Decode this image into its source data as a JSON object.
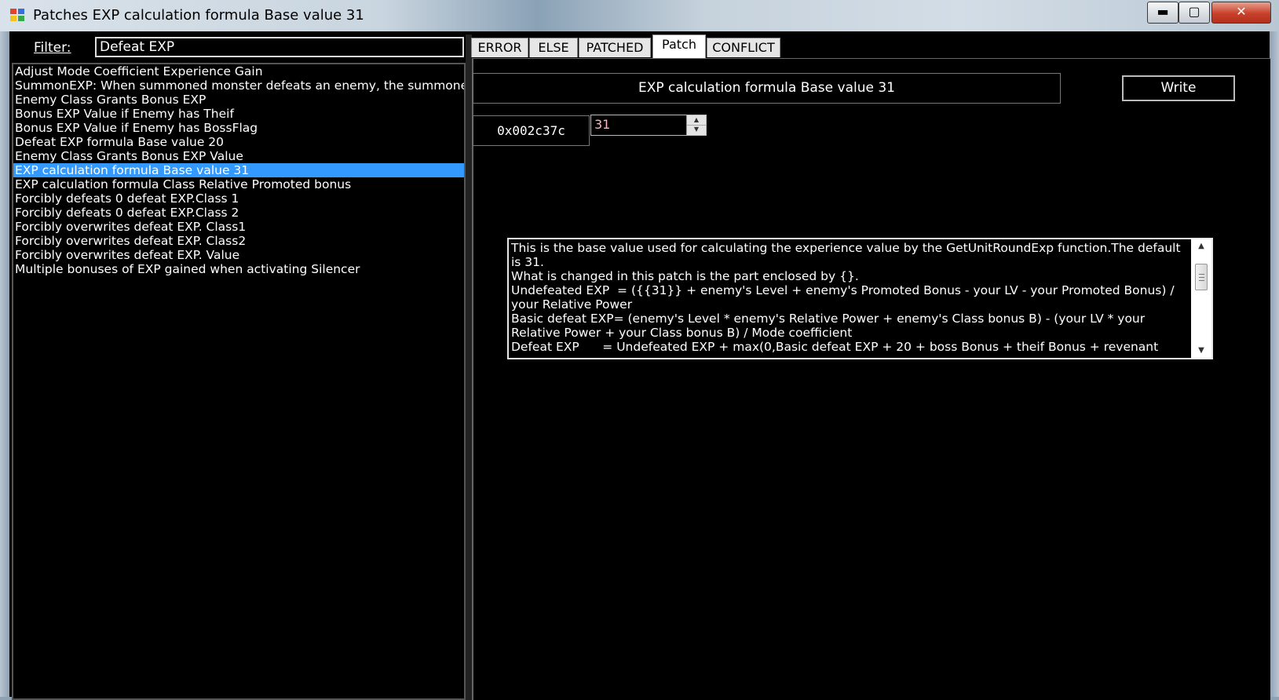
{
  "window": {
    "title": "Patches EXP calculation formula Base value 31",
    "min_icon": "minimize-icon",
    "max_icon": "maximize-icon",
    "close_icon": "close-icon",
    "min_glyph": "▬",
    "max_glyph": "▢",
    "close_glyph": "✕"
  },
  "filter": {
    "label": "Filter:",
    "value": "Defeat EXP"
  },
  "patch_list": {
    "items": [
      "Adjust Mode Coefficient Experience Gain",
      "SummonEXP: When summoned monster defeats an enemy, the summoner g",
      "Enemy Class Grants Bonus EXP",
      "Bonus EXP Value if Enemy has Theif",
      "Bonus EXP Value if Enemy has BossFlag",
      "Defeat EXP formula Base value 20",
      "Enemy Class Grants Bonus EXP Value",
      "EXP calculation formula Base value 31",
      "EXP calculation formula Class Relative Promoted bonus",
      "Forcibly defeats 0 defeat EXP.Class 1",
      "Forcibly defeats 0 defeat EXP.Class 2",
      "Forcibly overwrites defeat EXP. Class1",
      "Forcibly overwrites defeat EXP. Class2",
      "Forcibly overwrites defeat EXP. Value",
      "Multiple bonuses of EXP gained when activating Silencer"
    ],
    "selected_index": 7
  },
  "tabs": [
    {
      "label": "ERROR",
      "active": false
    },
    {
      "label": "ELSE",
      "active": false
    },
    {
      "label": "PATCHED",
      "active": false
    },
    {
      "label": "Patch",
      "active": true
    },
    {
      "label": "CONFLICT",
      "active": false
    }
  ],
  "patch": {
    "title": "EXP calculation formula Base value 31",
    "write_label": "Write",
    "address": "0x002c37c",
    "value": "31",
    "description": "This is the base value used for calculating the experience value by the GetUnitRoundExp function.The default is 31.\nWhat is changed in this patch is the part enclosed by {}.\nUndefeated EXP  = ({{31}} + enemy's Level + enemy's Promoted Bonus - your LV - your Promoted Bonus) / your Relative Power\nBasic defeat EXP= (enemy's Level * enemy's Relative Power + enemy's Class bonus B) - (your LV * your Relative Power + your Class bonus B) / Mode coefficient\nDefeat EXP      = Undefeated EXP + max(0,Basic defeat EXP + 20 + boss Bonus + theif Bonus + revenant"
  },
  "colors": {
    "selection": "#3399ff",
    "background": "#000000",
    "text": "#ffffff",
    "spin_value": "#ffb6c1"
  }
}
